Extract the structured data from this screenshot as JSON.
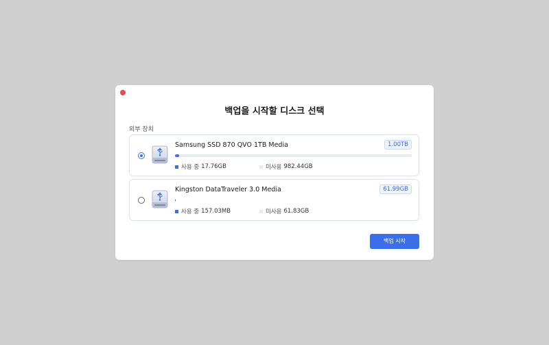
{
  "dialog": {
    "title": "백업을 시작할 디스크 선택",
    "section_label": "외부 장치",
    "start_button_label": "백업 시작"
  },
  "colors": {
    "accent": "#3b6ee8",
    "close_dot": "#e0504d",
    "backdrop": "#cfcfcf"
  },
  "devices": [
    {
      "name": "Samsung SSD 870 QVO 1TB Media",
      "capacity": "1.00TB",
      "selected": true,
      "used_label": "사용 중",
      "used_value": "17.76GB",
      "free_label": "미사용",
      "free_value": "982.44GB",
      "used_fraction": 0.018,
      "icon": "usb-drive-icon"
    },
    {
      "name": "Kingston DataTraveler 3.0 Media",
      "capacity": "61.99GB",
      "selected": false,
      "used_label": "사용 중",
      "used_value": "157.03MB",
      "free_label": "미사용",
      "free_value": "61.83GB",
      "used_fraction": 0.0025,
      "icon": "usb-drive-icon"
    }
  ]
}
